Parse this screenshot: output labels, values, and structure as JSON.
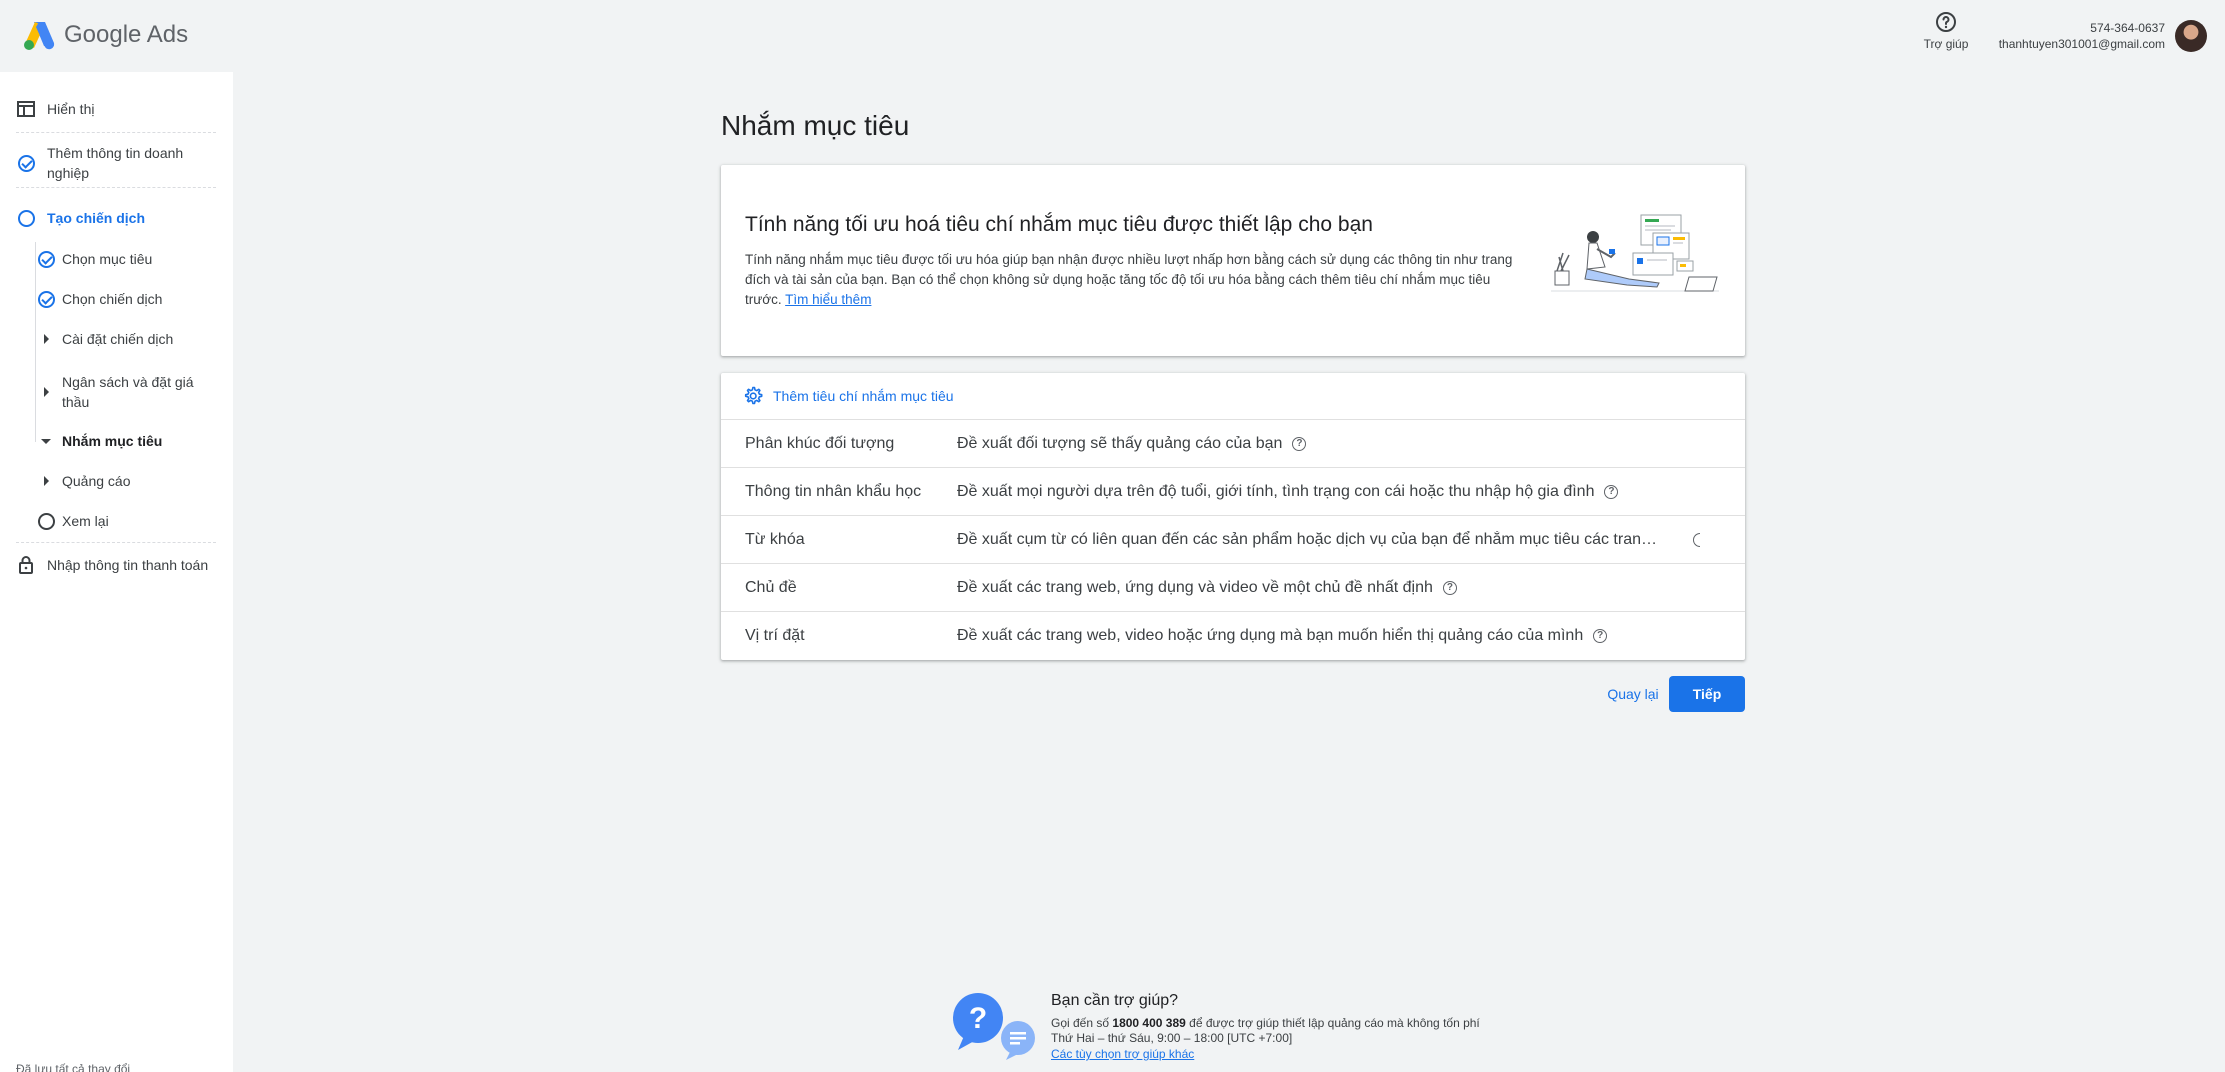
{
  "header": {
    "logo_text": "Google Ads",
    "help_label": "Trợ giúp",
    "account_phone": "574-364-0637",
    "account_email": "thanhtuyen301001@gmail.com"
  },
  "sidebar": {
    "items": [
      {
        "label": "Hiển thị",
        "icon": "display-icon"
      },
      {
        "label": "Thêm thông tin doanh nghiệp",
        "icon": "check-circle-icon"
      },
      {
        "label": "Tạo chiến dịch",
        "icon": "circle-icon"
      },
      {
        "label": "Chọn mục tiêu",
        "icon": "check-circle-icon"
      },
      {
        "label": "Chọn chiến dịch",
        "icon": "check-circle-icon"
      },
      {
        "label": "Cài đặt chiến dịch",
        "icon": "triangle-right-icon"
      },
      {
        "label": "Ngân sách và đặt giá thầu",
        "icon": "triangle-right-icon"
      },
      {
        "label": "Nhắm mục tiêu",
        "icon": "triangle-down-icon"
      },
      {
        "label": "Quảng cáo",
        "icon": "triangle-right-icon"
      },
      {
        "label": "Xem lại",
        "icon": "circle-icon"
      },
      {
        "label": "Nhập thông tin thanh toán",
        "icon": "lock-icon"
      }
    ],
    "bottom_text": "Đã lưu tất cả thay đổi"
  },
  "main": {
    "title": "Nhắm mục tiêu",
    "info_card": {
      "title": "Tính năng tối ưu hoá tiêu chí nhắm mục tiêu được thiết lập cho bạn",
      "text": "Tính năng nhắm mục tiêu được tối ưu hóa giúp bạn nhận được nhiều lượt nhấp hơn bằng cách sử dụng các thông tin như trang đích và tài sản của bạn. Bạn có thể chọn không sử dụng hoặc tăng tốc độ tối ưu hóa bằng cách thêm tiêu chí nhắm mục tiêu trước.",
      "link": "Tìm hiểu thêm"
    },
    "add_targeting_label": "Thêm tiêu chí nhắm mục tiêu",
    "targeting_rows": [
      {
        "name": "Phân khúc đối tượng",
        "desc": "Đề xuất đối tượng sẽ thấy quảng cáo của bạn"
      },
      {
        "name": "Thông tin nhân khẩu học",
        "desc": "Đề xuất mọi người dựa trên độ tuổi, giới tính, tình trạng con cái hoặc thu nhập hộ gia đình"
      },
      {
        "name": "Từ khóa",
        "desc": "Đề xuất cụm từ có liên quan đến các sản phẩm hoặc dịch vụ của bạn để nhắm mục tiêu các tran…"
      },
      {
        "name": "Chủ đề",
        "desc": "Đề xuất các trang web, ứng dụng và video về một chủ đề nhất định"
      },
      {
        "name": "Vị trí đặt",
        "desc": "Đề xuất các trang web, video hoặc ứng dụng mà bạn muốn hiển thị quảng cáo của mình"
      }
    ],
    "back_label": "Quay lại",
    "next_label": "Tiếp"
  },
  "support": {
    "title": "Bạn cần trợ giúp?",
    "line1_prefix": "Gọi đến số",
    "phone": "1800 400 389",
    "line1_suffix": "để được trợ giúp thiết lập quảng cáo mà không tốn phí",
    "hours": "Thứ Hai – thứ Sáu, 9:00 – 18:00 [UTC +7:00]",
    "link": "Các tùy chọn trợ giúp khác"
  },
  "colors": {
    "accent": "#1a73e8",
    "background": "#f1f3f4"
  }
}
